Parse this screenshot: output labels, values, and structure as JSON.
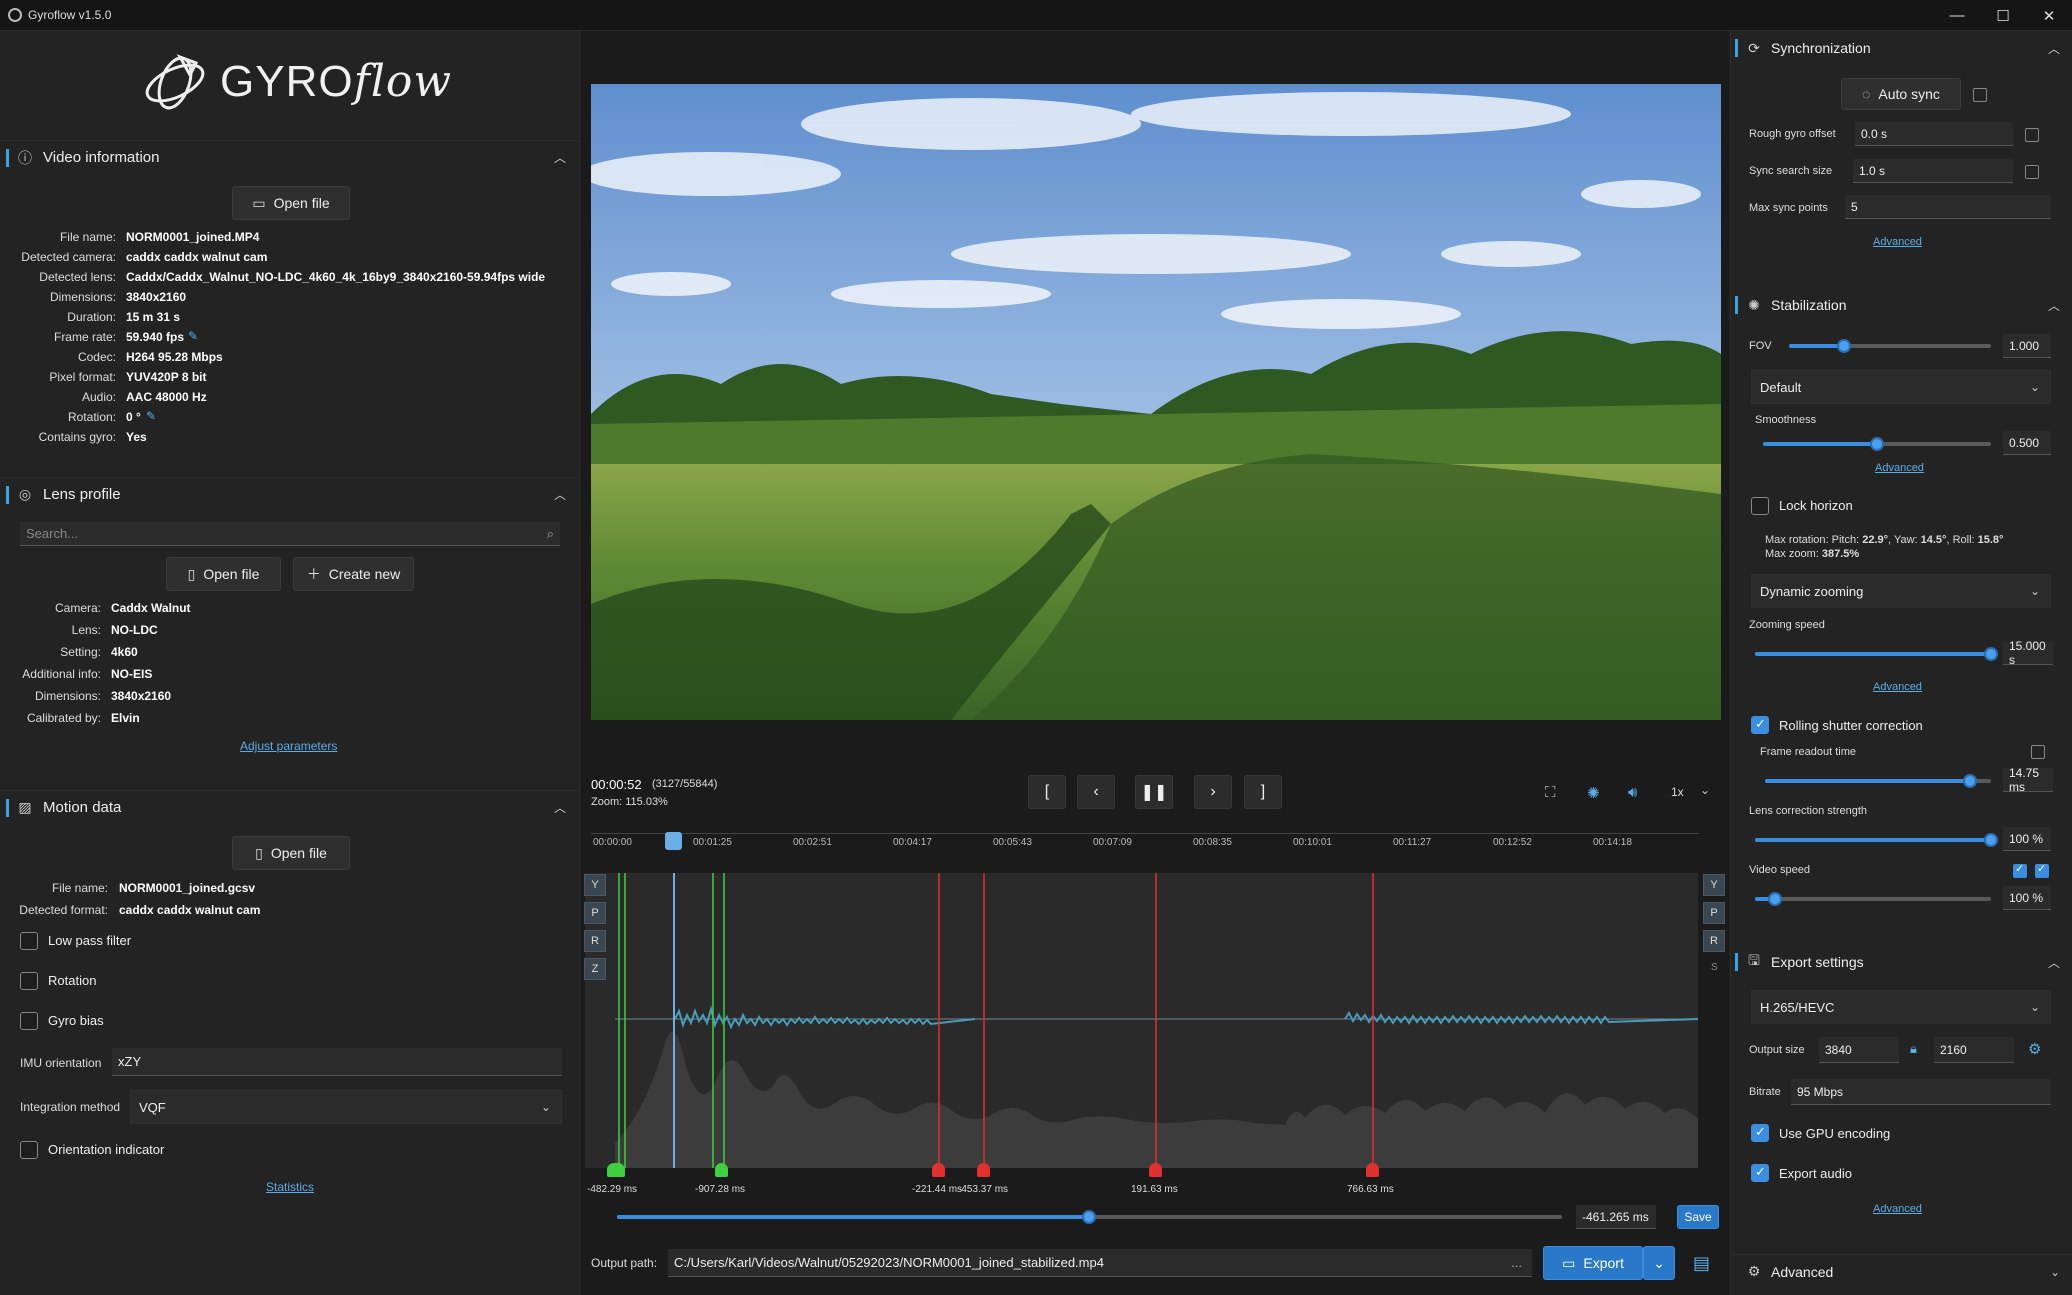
{
  "window": {
    "title": "Gyroflow v1.5.0"
  },
  "logo": {
    "text_main": "GYRO",
    "text_script": "flow"
  },
  "video_info": {
    "title": "Video information",
    "open_label": "Open file",
    "rows": [
      {
        "k": "File name:",
        "v": "NORM0001_joined.MP4"
      },
      {
        "k": "Detected camera:",
        "v": "caddx caddx walnut cam"
      },
      {
        "k": "Detected lens:",
        "v": "Caddx/Caddx_Walnut_NO-LDC_4k60_4k_16by9_3840x2160-59.94fps wide"
      },
      {
        "k": "Dimensions:",
        "v": "3840x2160"
      },
      {
        "k": "Duration:",
        "v": "15 m 31 s"
      },
      {
        "k": "Frame rate:",
        "v": "59.940 fps"
      },
      {
        "k": "Codec:",
        "v": "H264 95.28 Mbps"
      },
      {
        "k": "Pixel format:",
        "v": "YUV420P 8 bit"
      },
      {
        "k": "Audio:",
        "v": "AAC 48000 Hz"
      },
      {
        "k": "Rotation:",
        "v": "0 °"
      },
      {
        "k": "Contains gyro:",
        "v": "Yes"
      }
    ]
  },
  "lens_profile": {
    "title": "Lens profile",
    "search_placeholder": "Search...",
    "open_label": "Open file",
    "create_label": "Create new",
    "rows": [
      {
        "k": "Camera:",
        "v": "Caddx Walnut"
      },
      {
        "k": "Lens:",
        "v": "NO-LDC"
      },
      {
        "k": "Setting:",
        "v": "4k60"
      },
      {
        "k": "Additional info:",
        "v": "NO-EIS"
      },
      {
        "k": "Dimensions:",
        "v": "3840x2160"
      },
      {
        "k": "Calibrated by:",
        "v": "Elvin"
      }
    ],
    "adjust_label": "Adjust parameters"
  },
  "motion_data": {
    "title": "Motion data",
    "open_label": "Open file",
    "rows": [
      {
        "k": "File name:",
        "v": "NORM0001_joined.gcsv"
      },
      {
        "k": "Detected format:",
        "v": "caddx caddx walnut cam"
      }
    ],
    "low_pass": "Low pass filter",
    "rotation": "Rotation",
    "gyro_bias": "Gyro bias",
    "imu_label": "IMU orientation",
    "imu_value": "xZY",
    "integration_label": "Integration method",
    "integration_value": "VQF",
    "orientation_indicator": "Orientation indicator",
    "statistics": "Statistics"
  },
  "player": {
    "time": "00:00:52",
    "frames": "(3127/55844)",
    "zoom": "Zoom: 115.03%",
    "speed": "1x",
    "ticks": [
      "00:00:00",
      "00:01:25",
      "00:02:51",
      "00:04:17",
      "00:05:43",
      "00:07:09",
      "00:08:35",
      "00:10:01",
      "00:11:27",
      "00:12:52",
      "00:14:18"
    ],
    "axes_left": [
      "Y",
      "P",
      "R",
      "Z"
    ],
    "axes_right": [
      "Y",
      "P",
      "R",
      "S"
    ],
    "sync_points": [
      "-482.29 ms",
      "-907.28 ms",
      "-221.44 ms",
      "-453.37 ms",
      "191.63 ms",
      "766.63 ms"
    ],
    "offset_value": "-461.265 ms",
    "save_label": "Save"
  },
  "output": {
    "label": "Output path:",
    "path": "C:/Users/Karl/Videos/Walnut/05292023/NORM0001_joined_stabilized.mp4",
    "dots": "...",
    "export_label": "Export"
  },
  "sync": {
    "title": "Synchronization",
    "autosync_label": "Auto sync",
    "rough_label": "Rough gyro offset",
    "rough_value": "0.0 s",
    "search_label": "Sync search size",
    "search_value": "1.0 s",
    "max_label": "Max sync points",
    "max_value": "5",
    "advanced": "Advanced"
  },
  "stab": {
    "title": "Stabilization",
    "fov_label": "FOV",
    "fov_value": "1.000",
    "fov_level": 0.27,
    "method": "Default",
    "smooth_label": "Smoothness",
    "smooth_value": "0.500",
    "smooth_level": 0.5,
    "advanced": "Advanced",
    "lock_horizon": "Lock horizon",
    "max_rot_prefix": "Max rotation: Pitch: ",
    "pitch": "22.9°",
    "yaw_prefix": ", Yaw: ",
    "yaw": "14.5°",
    "roll_prefix": ", Roll: ",
    "roll": "15.8°",
    "max_zoom_prefix": "Max zoom: ",
    "max_zoom": "387.5%",
    "zooming": "Dynamic zooming",
    "zoom_speed_label": "Zooming speed",
    "zoom_speed_value": "15.000 s",
    "advanced2": "Advanced",
    "rs_label": "Rolling shutter correction",
    "frame_readout": "Frame readout time",
    "readout_value": "14.75 ms",
    "lens_strength": "Lens correction strength",
    "lens_value": "100 %",
    "video_speed": "Video speed",
    "speed_value": "100 %"
  },
  "export": {
    "title": "Export settings",
    "codec": "H.265/HEVC",
    "size_label": "Output size",
    "width": "3840",
    "height": "2160",
    "bitrate_label": "Bitrate",
    "bitrate": "95 Mbps",
    "gpu": "Use GPU encoding",
    "audio": "Export audio",
    "advanced": "Advanced"
  },
  "advanced_section": {
    "title": "Advanced"
  }
}
